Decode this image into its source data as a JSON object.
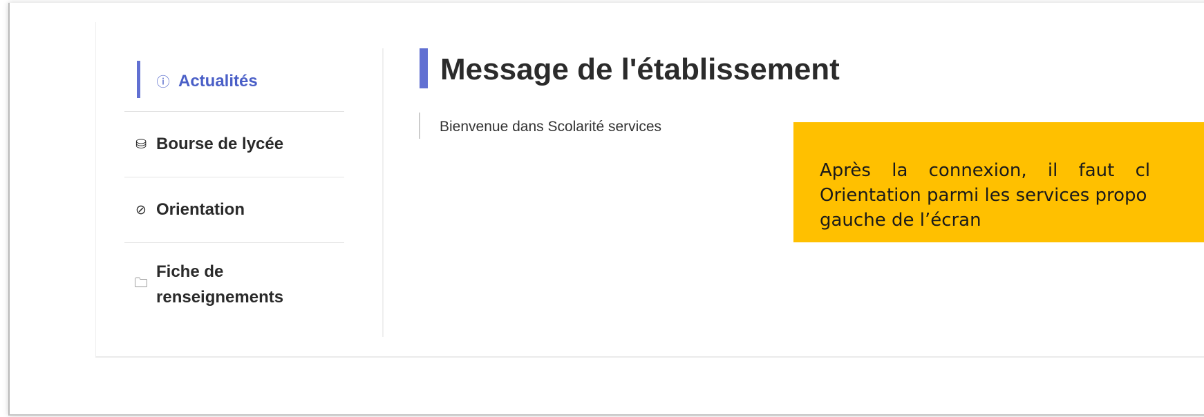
{
  "sidebar": {
    "items": [
      {
        "label": "Actualités",
        "icon": "info-circle-icon",
        "glyph": "ⓘ",
        "active": true
      },
      {
        "label": "Bourse de lycée",
        "icon": "scholarship-icon",
        "glyph": "⛁",
        "active": false
      },
      {
        "label": "Orientation",
        "icon": "compass-icon",
        "glyph": "⊘",
        "active": false
      },
      {
        "label": "Fiche de renseignements",
        "icon": "document-icon",
        "glyph": "🗀",
        "active": false
      }
    ]
  },
  "main": {
    "title": "Message de l'établissement",
    "message": "Bienvenue dans Scolarité services"
  },
  "callout": {
    "line1": "Après la connexion, il faut cl",
    "line2": "Orientation parmi les services propo",
    "line3": "gauche de l’écran"
  },
  "colors": {
    "accent": "#6170d2",
    "active_text": "#4a5fc7",
    "callout_bg": "#ffc000"
  }
}
